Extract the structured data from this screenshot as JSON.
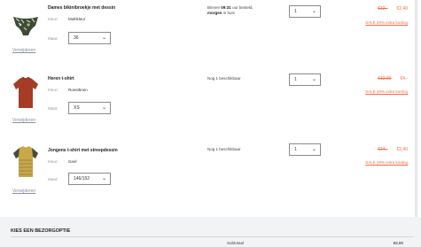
{
  "items": [
    {
      "name": "Dames bikinibroekje met dessin",
      "color_label": "Kleur:",
      "color": "Multikleur",
      "size_label": "Maat:",
      "size": "36",
      "remove": "Verwijderen",
      "delivery_line1": "Binnen",
      "delivery_time": "09:31",
      "delivery_line1_rest": "uur besteld,",
      "delivery_bold": "morgen",
      "delivery_rest": "in huis",
      "quantity": "1",
      "old_price": "€12,-",
      "new_price": "€2,40",
      "discount": "SALE 20% extra korting"
    },
    {
      "name": "Heren t-shirt",
      "color_label": "Kleur:",
      "color": "Roestbruin",
      "size_label": "Maat:",
      "size": "XS",
      "remove": "Verwijderen",
      "availability": "Nog 1 beschikbaar",
      "quantity": "1",
      "old_price": "€12,99",
      "new_price": "€4,-",
      "discount": "SALE 20% extra korting"
    },
    {
      "name": "Jongens t-shirt met streepdessin",
      "color_label": "Kleur:",
      "color": "Geel",
      "size_label": "Maat:",
      "size": "146/152",
      "remove": "Verwijderen",
      "availability": "Nog 1 beschikbaar",
      "quantity": "1",
      "old_price": "€14,-",
      "new_price": "€2,40",
      "discount": "SALE 20% extra korting"
    }
  ],
  "footer": {
    "title": "KIES EEN BEZORGOPTIE",
    "subtotal_label": "Subtotaal",
    "subtotal_value": "€8,80"
  },
  "colors": {
    "accent": "#ff6a3d",
    "footer_bg": "#f2f3f5"
  }
}
